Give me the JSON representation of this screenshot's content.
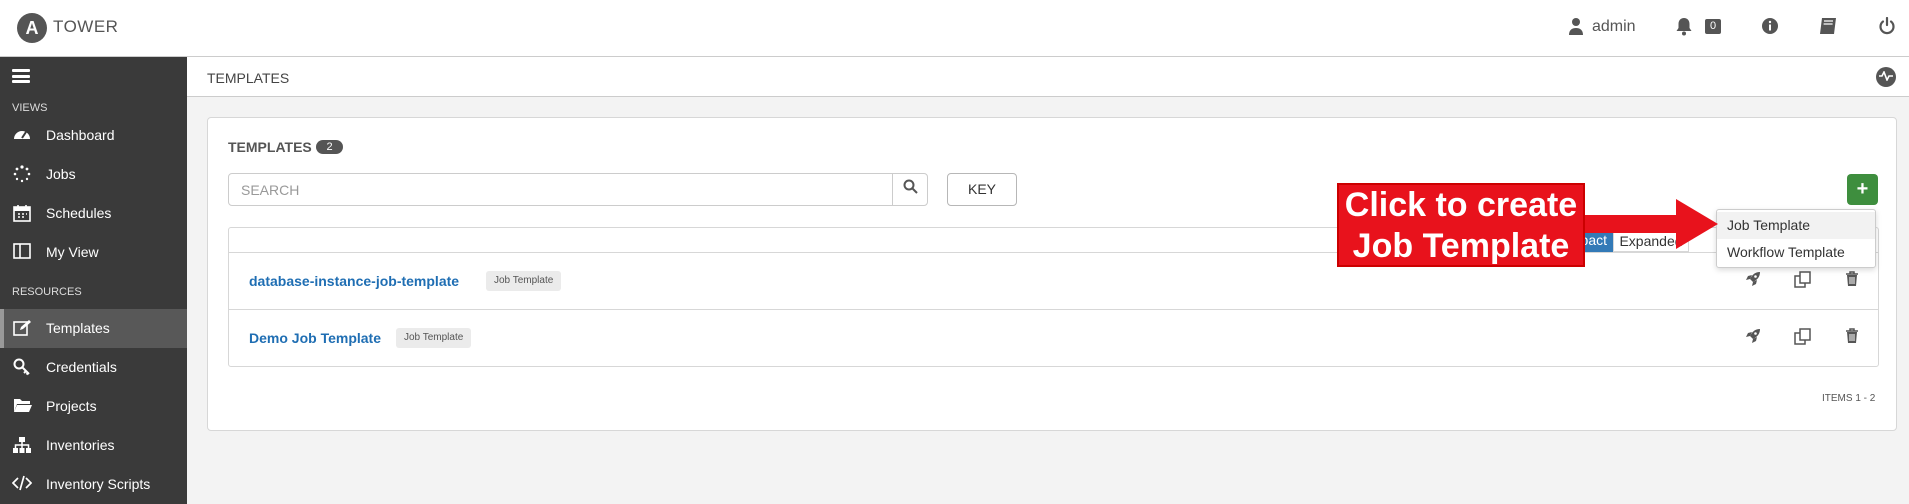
{
  "app": {
    "brand": "TOWER",
    "logo_letter": "A"
  },
  "header": {
    "user": "admin",
    "notification_count": "0",
    "icons": [
      "user-icon",
      "bell-icon",
      "info-icon",
      "book-icon",
      "power-icon"
    ]
  },
  "sidebar": {
    "sections": {
      "views": "VIEWS",
      "resources": "RESOURCES"
    },
    "items": [
      {
        "label": "Dashboard",
        "icon": "dashboard-icon"
      },
      {
        "label": "Jobs",
        "icon": "spinner-icon"
      },
      {
        "label": "Schedules",
        "icon": "calendar-icon"
      },
      {
        "label": "My View",
        "icon": "columns-icon"
      },
      {
        "label": "Templates",
        "icon": "edit-icon",
        "active": true
      },
      {
        "label": "Credentials",
        "icon": "key-icon"
      },
      {
        "label": "Projects",
        "icon": "folder-icon"
      },
      {
        "label": "Inventories",
        "icon": "sitemap-icon"
      },
      {
        "label": "Inventory Scripts",
        "icon": "code-icon"
      }
    ]
  },
  "breadcrumb": {
    "current": "TEMPLATES"
  },
  "panel": {
    "title": "TEMPLATES",
    "count": "2",
    "search_placeholder": "SEARCH",
    "key_label": "KEY",
    "add_label": "+",
    "view_toggle": {
      "compact": "Compact",
      "compact_visible": "pact",
      "expanded": "Expanded"
    },
    "rows": [
      {
        "name": "database-instance-job-template",
        "type": "Job Template"
      },
      {
        "name": "Demo Job Template",
        "type": "Job Template"
      }
    ],
    "items_label": "ITEMS  1 - 2"
  },
  "add_menu": {
    "items": [
      "Job Template",
      "Workflow Template"
    ]
  },
  "annotation": {
    "line1": "Click to create",
    "line2": "Job Template",
    "color": "#e8121c"
  },
  "colors": {
    "sidebar_bg": "#3a3a3a",
    "link": "#1f6eb3",
    "add_button": "#3e8e3e",
    "toggle_active": "#337ab7"
  }
}
